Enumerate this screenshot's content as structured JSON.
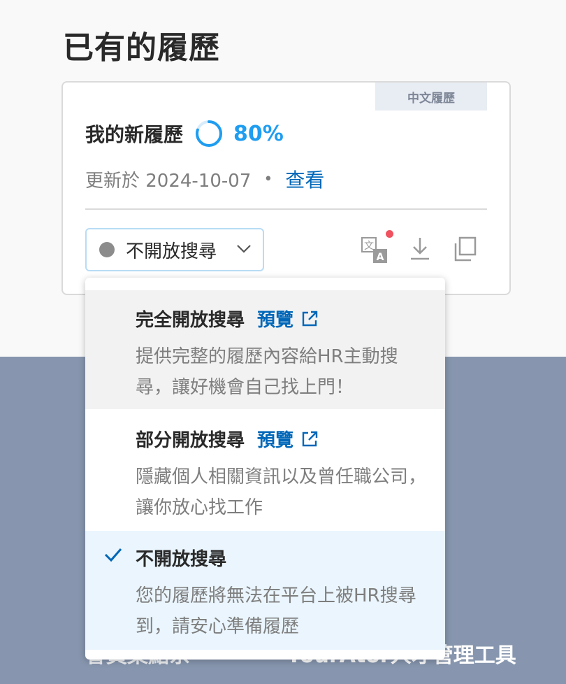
{
  "page": {
    "section_title": "已有的履歷"
  },
  "resume": {
    "language_tag": "中文履歷",
    "name": "我的新履歷",
    "completion_percent": 80,
    "completion_text": "80%",
    "updated_text": "更新於 2024-10-07",
    "separator": "•",
    "view_label": "查看"
  },
  "search_select": {
    "current_value": "不開放搜尋"
  },
  "dropdown": {
    "options": [
      {
        "title": "完全開放搜尋",
        "preview": "預覽",
        "description": "提供完整的履歷內容給HR主動搜尋，讓好機會自己找上門！",
        "selected": false
      },
      {
        "title": "部分開放搜尋",
        "preview": "預覽",
        "description": "隱藏個人相關資訊以及曾任職公司，讓你放心找工作",
        "selected": false
      },
      {
        "title": "不開放搜尋",
        "preview": "",
        "description": "您的履歷將無法在平台上被HR搜尋到，請安心準備履歷",
        "selected": true
      }
    ]
  },
  "footer": {
    "left_peek": "會員集點系",
    "right_peek": "YourAtor人才管理工具"
  },
  "icons": {
    "translate": "translate-icon",
    "download": "download-icon",
    "copy": "copy-icon",
    "external": "external-link-icon",
    "check": "check-icon",
    "chevron": "chevron-down-icon"
  },
  "colors": {
    "accent_blue": "#0067b8",
    "progress_blue": "#1f9df0",
    "notify_red": "#f0525f",
    "footer_bg": "#8796ae",
    "selected_bg": "#eaf5fd"
  }
}
